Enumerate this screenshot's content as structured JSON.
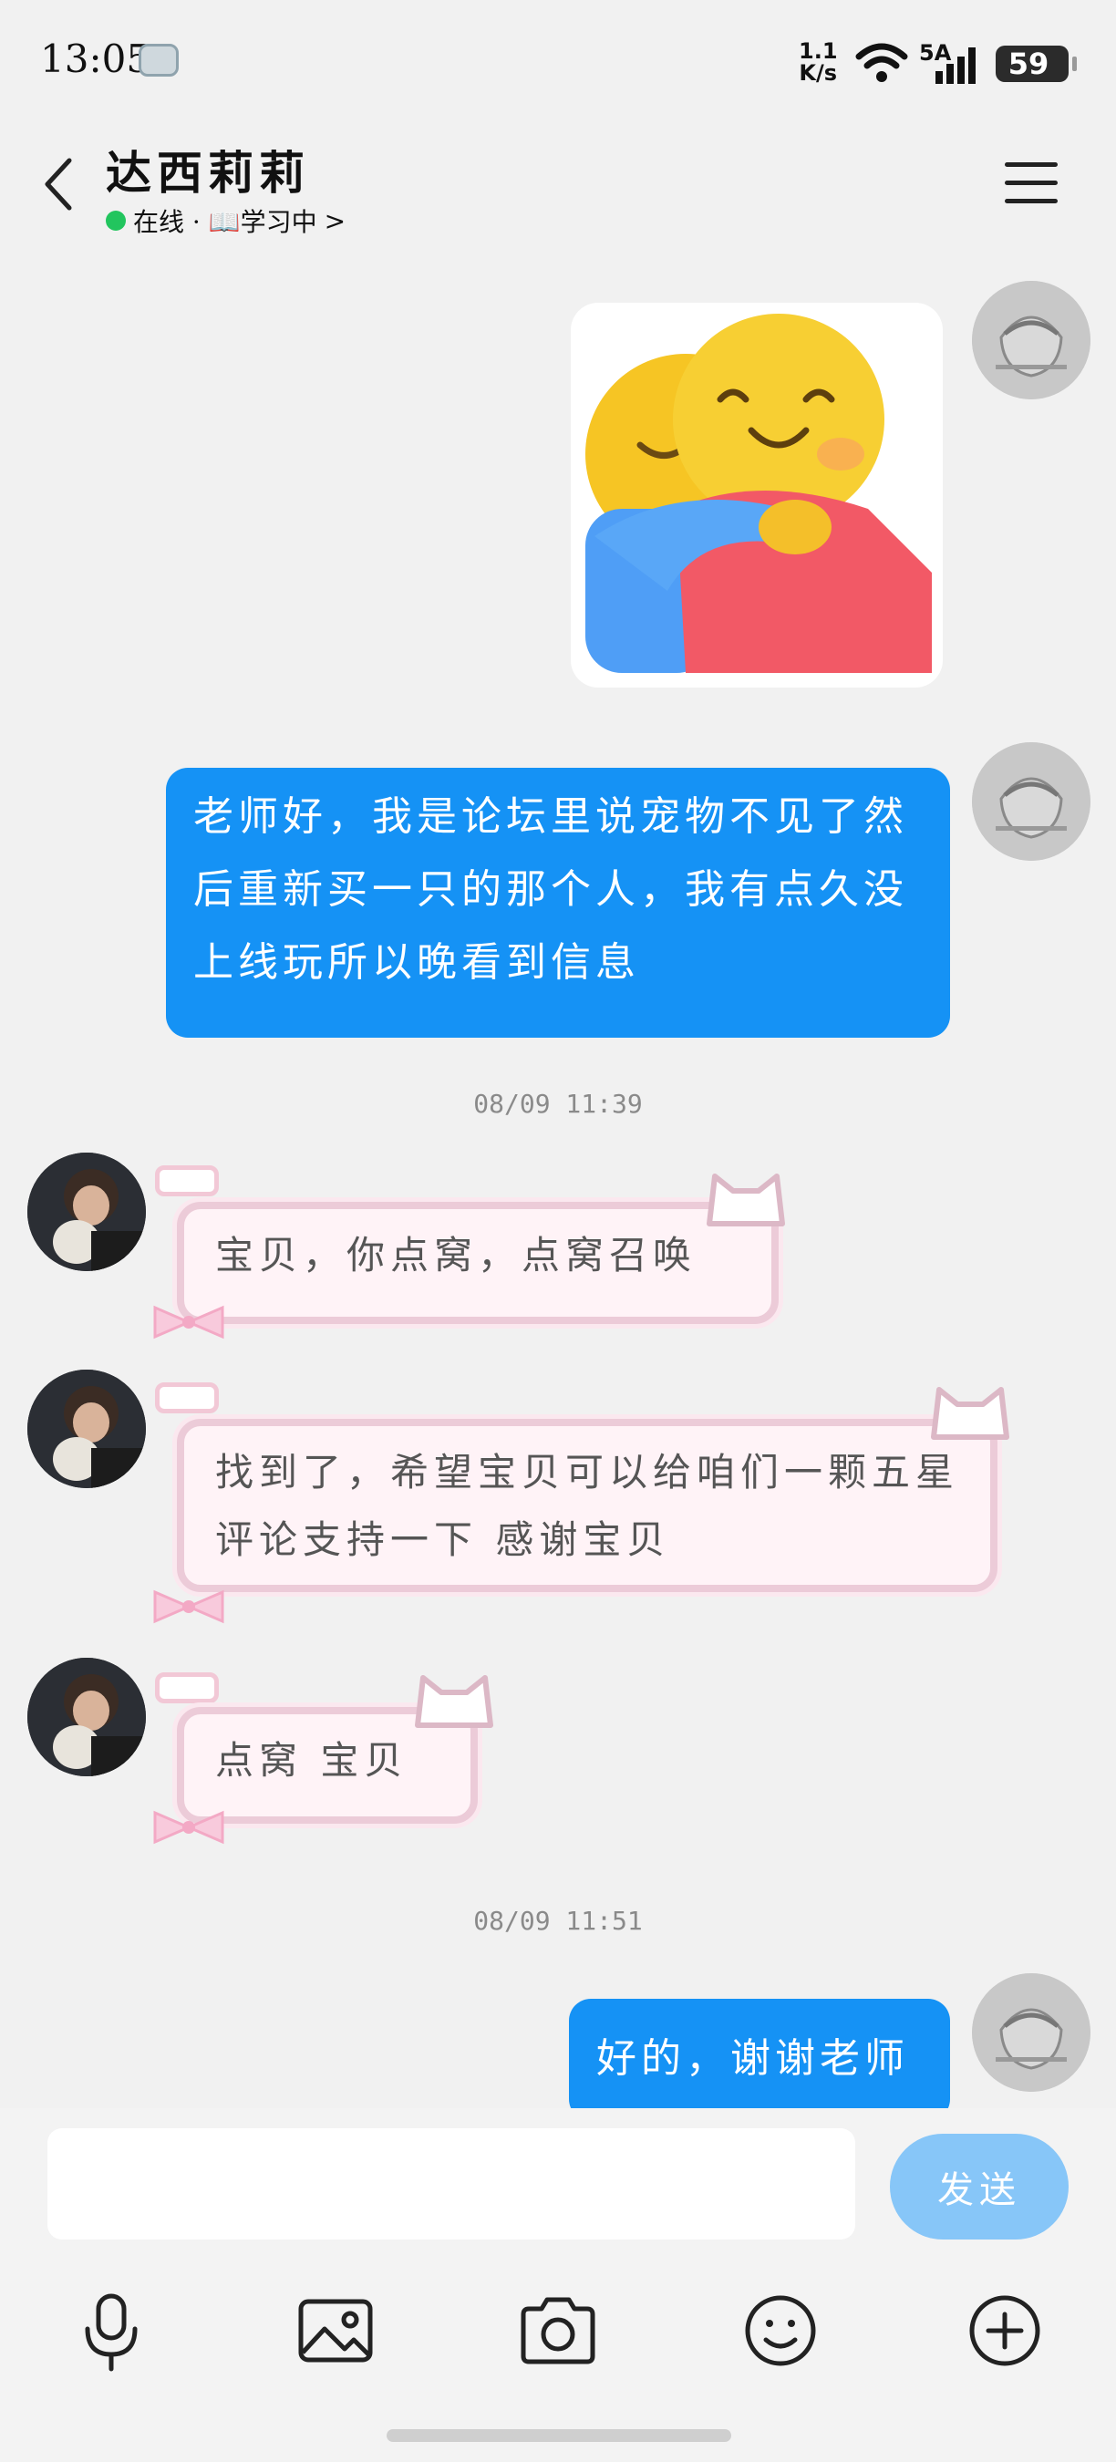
{
  "status_bar": {
    "time": "13:05",
    "net_speed_value": "1.1",
    "net_speed_unit": "K/s",
    "signal_label": "5A",
    "battery": "59"
  },
  "header": {
    "title": "达西莉莉",
    "presence": "在线 · 📖学习中",
    "chevron": ">"
  },
  "messages": [
    {
      "side": "right",
      "type": "sticker",
      "sticker": "hug-emoji"
    },
    {
      "side": "right",
      "type": "text",
      "text": "老师好，我是论坛里说宠物不见了然后重新买一只的那个人，我有点久没上线玩所以晚看到信息"
    },
    {
      "type": "time",
      "text": "08/09 11:39"
    },
    {
      "side": "left",
      "type": "text",
      "text": "宝贝，你点窝，点窝召唤"
    },
    {
      "side": "left",
      "type": "text",
      "text": "找到了，希望宝贝可以给咱们一颗五星评论支持一下 感谢宝贝"
    },
    {
      "side": "left",
      "type": "text",
      "text": "点窝 宝贝"
    },
    {
      "type": "time",
      "text": "08/09 11:51"
    },
    {
      "side": "right",
      "type": "text",
      "text": "好的，谢谢老师"
    }
  ],
  "composer": {
    "input_value": "",
    "send_label": "发送"
  },
  "toolbar_icons": [
    "microphone-icon",
    "image-icon",
    "camera-icon",
    "emoji-icon",
    "plus-icon"
  ],
  "colors": {
    "self_bubble": "#1592f5",
    "other_bubble_bg": "#fff3f7",
    "other_bubble_border": "#eccbd8",
    "online_dot": "#22c55e",
    "send_button": "#87c6f8"
  }
}
